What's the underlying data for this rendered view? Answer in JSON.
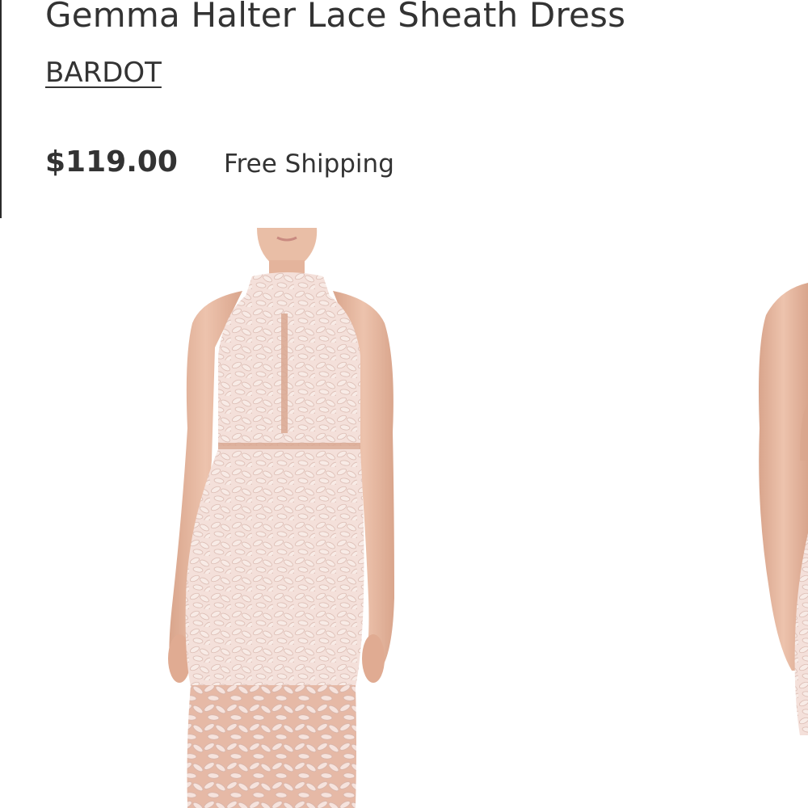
{
  "product": {
    "title": "Gemma Halter Lace Sheath Dress",
    "brand": "BARDOT",
    "price": "$119.00",
    "shipping": "Free Shipping"
  },
  "gallery": {
    "images": [
      {
        "name": "dress-front-image",
        "description_icon": "product-photo"
      },
      {
        "name": "dress-back-image",
        "description_icon": "product-photo"
      }
    ]
  },
  "colors": {
    "text": "#333333",
    "skin": "#e8b9a0",
    "lace": "#f3dcd6",
    "lace_shadow": "#e2c2ba"
  }
}
